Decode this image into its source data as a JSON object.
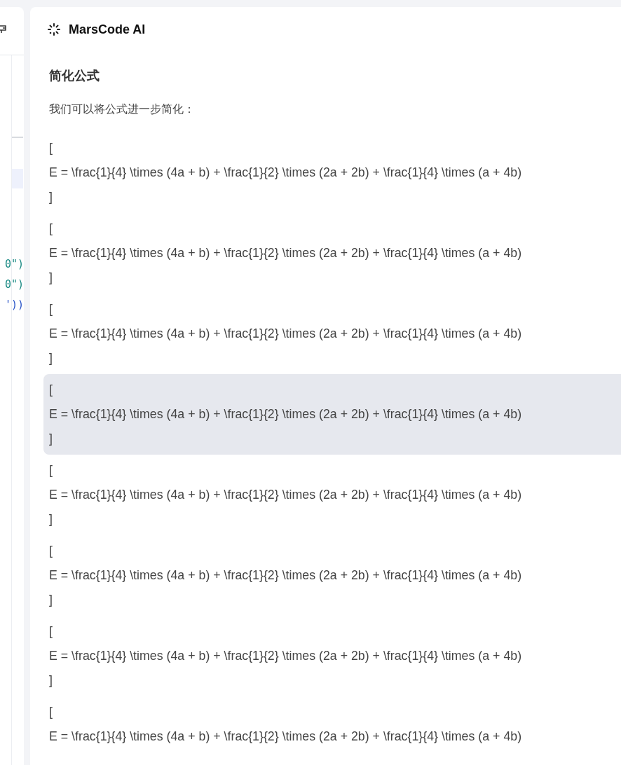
{
  "editor": {
    "code_lines": [
      "0\")",
      "0\")",
      "'))"
    ]
  },
  "chat": {
    "title": "MarsCode AI",
    "heading": "简化公式",
    "intro": "我们可以将公式进一步简化：",
    "blocks": [
      {
        "open": "[",
        "formula": "E = \\frac{1}{4} \\times (4a + b) + \\frac{1}{2} \\times (2a + 2b) + \\frac{1}{4} \\times (a + 4b)",
        "close": "]",
        "selected": false
      },
      {
        "open": "[",
        "formula": "E = \\frac{1}{4} \\times (4a + b) + \\frac{1}{2} \\times (2a + 2b) + \\frac{1}{4} \\times (a + 4b)",
        "close": "]",
        "selected": false
      },
      {
        "open": "[",
        "formula": "E = \\frac{1}{4} \\times (4a + b) + \\frac{1}{2} \\times (2a + 2b) + \\frac{1}{4} \\times (a + 4b)",
        "close": "]",
        "selected": false
      },
      {
        "open": "[",
        "formula": "E = \\frac{1}{4} \\times (4a + b) + \\frac{1}{2} \\times (2a + 2b) + \\frac{1}{4} \\times (a + 4b)",
        "close": "]",
        "selected": true
      },
      {
        "open": "[",
        "formula": "E = \\frac{1}{4} \\times (4a + b) + \\frac{1}{2} \\times (2a + 2b) + \\frac{1}{4} \\times (a + 4b)",
        "close": "]",
        "selected": false
      },
      {
        "open": "[",
        "formula": "E = \\frac{1}{4} \\times (4a + b) + \\frac{1}{2} \\times (2a + 2b) + \\frac{1}{4} \\times (a + 4b)",
        "close": "]",
        "selected": false
      },
      {
        "open": "[",
        "formula": "E = \\frac{1}{4} \\times (4a + b) + \\frac{1}{2} \\times (2a + 2b) + \\frac{1}{4} \\times (a + 4b)",
        "close": "]",
        "selected": false
      },
      {
        "open": "[",
        "formula": "E = \\frac{1}{4} \\times (4a + b) + \\frac{1}{2} \\times (2a + 2b) + \\frac{1}{4} \\times (a + 4b)",
        "selected": false
      }
    ]
  }
}
